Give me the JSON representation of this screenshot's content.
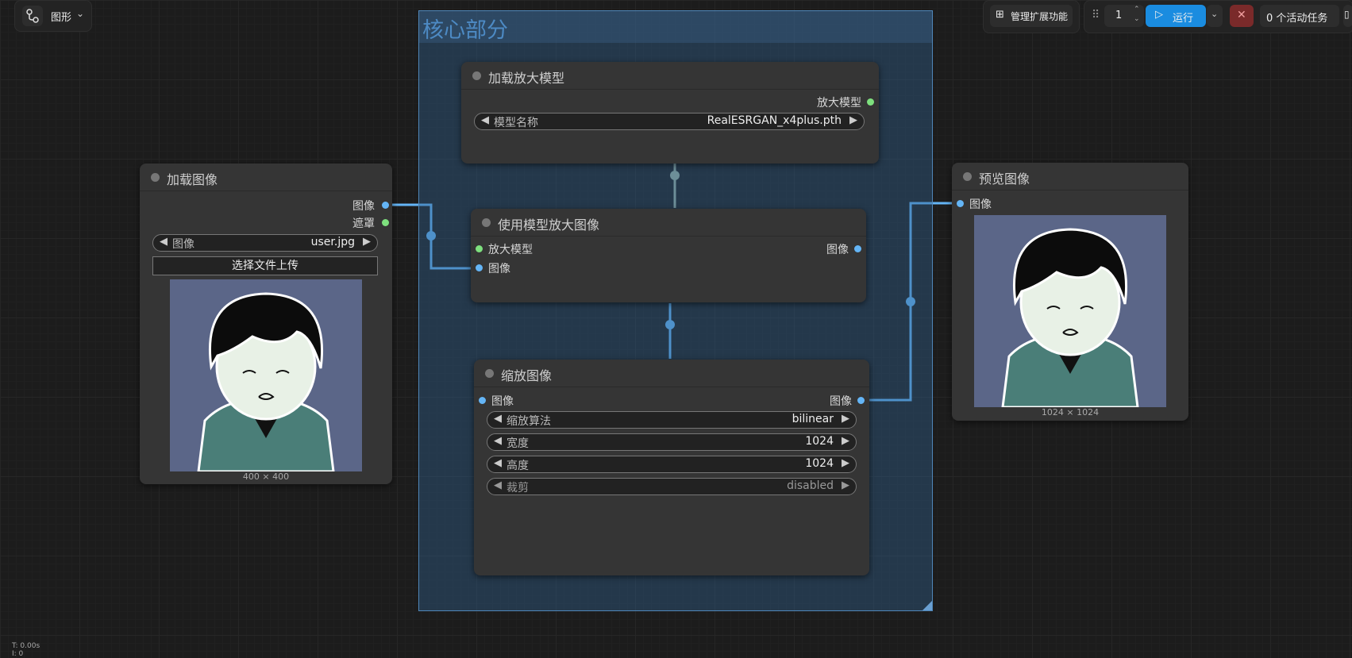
{
  "topbar": {
    "graph_label": "图形",
    "manage_ext_label": "管理扩展功能",
    "queue_count": "1",
    "run_label": "运行",
    "active_tasks_label": "0 个活动任务"
  },
  "group": {
    "title": "核心部分"
  },
  "nodes": {
    "load_image": {
      "title": "加载图像",
      "out_image": "图像",
      "out_mask": "遮罩",
      "widget_name": "图像",
      "widget_value": "user.jpg",
      "upload_label": "选择文件上传",
      "size_label": "400 × 400"
    },
    "load_upscale_model": {
      "title": "加载放大模型",
      "out_model": "放大模型",
      "widget_name": "模型名称",
      "widget_value": "RealESRGAN_x4plus.pth"
    },
    "upscale_with_model": {
      "title": "使用模型放大图像",
      "in_model": "放大模型",
      "in_image": "图像",
      "out_image": "图像"
    },
    "scale_image": {
      "title": "缩放图像",
      "in_image": "图像",
      "out_image": "图像",
      "widgets": [
        {
          "name": "缩放算法",
          "value": "bilinear"
        },
        {
          "name": "宽度",
          "value": "1024"
        },
        {
          "name": "高度",
          "value": "1024"
        },
        {
          "name": "裁剪",
          "value": "disabled"
        }
      ]
    },
    "preview_image": {
      "title": "预览图像",
      "in_image": "图像",
      "size_label": "1024 × 1024"
    }
  },
  "status": {
    "time": "T: 0.00s",
    "iter": "I: 0"
  },
  "colors": {
    "link_image": "#64b5f6",
    "link_model": "#9ab0a0",
    "accent": "#1a8ce0",
    "cancel": "#7a2a2a"
  }
}
